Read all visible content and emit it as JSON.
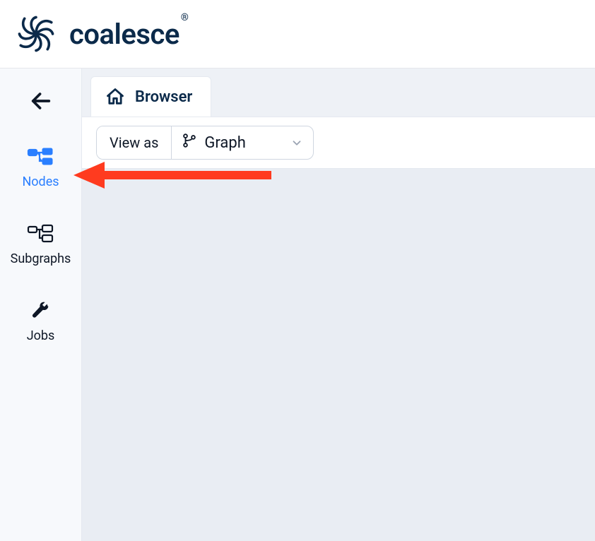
{
  "brand": {
    "name": "coalesce",
    "reg": "®"
  },
  "sidebar": {
    "items": [
      {
        "label": "Nodes"
      },
      {
        "label": "Subgraphs"
      },
      {
        "label": "Jobs"
      }
    ]
  },
  "tabs": [
    {
      "label": "Browser"
    }
  ],
  "toolbar": {
    "viewas_prefix": "View as",
    "viewas_value": "Graph"
  }
}
